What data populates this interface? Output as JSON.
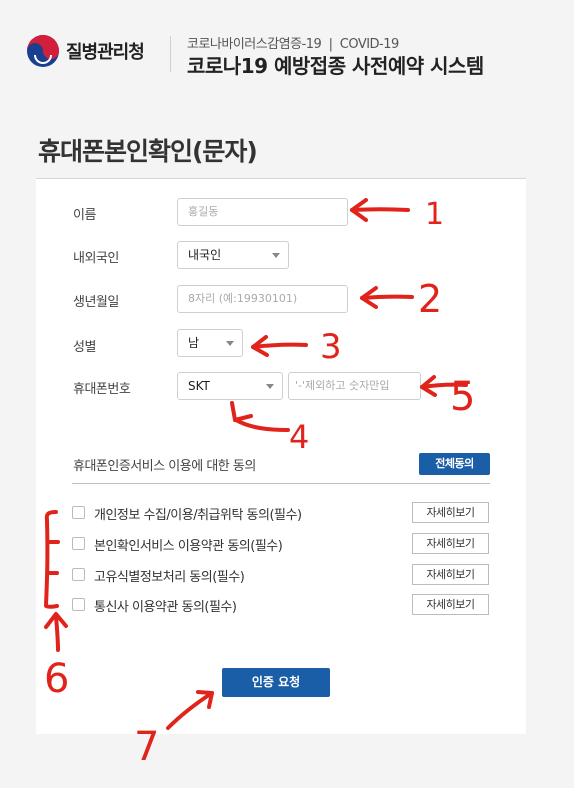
{
  "header": {
    "org_name": "질병관리청",
    "subtitle": "코로나바이러스감염증-19  |  COVID-19",
    "title": "코로나19 예방접종 사전예약 시스템"
  },
  "page_title": "휴대폰본인확인(문자)",
  "form": {
    "name_label": "이름",
    "name_placeholder": "홍길동",
    "nationality_label": "내외국인",
    "nationality_value": "내국인",
    "birth_label": "생년월일",
    "birth_placeholder": "8자리 (예:19930101)",
    "gender_label": "성별",
    "gender_value": "남",
    "phone_label": "휴대폰번호",
    "carrier_value": "SKT",
    "phone_placeholder": "'-'제외하고 숫자만입"
  },
  "consent": {
    "heading": "휴대폰인증서비스 이용에 대한 동의",
    "agree_all_label": "전체동의",
    "items": [
      {
        "label": "개인정보 수집/이용/취급위탁 동의(필수)",
        "detail": "자세히보기"
      },
      {
        "label": "본인확인서비스 이용약관 동의(필수)",
        "detail": "자세히보기"
      },
      {
        "label": "고유식별정보처리 동의(필수)",
        "detail": "자세히보기"
      },
      {
        "label": "통신사 이용약관 동의(필수)",
        "detail": "자세히보기"
      }
    ]
  },
  "submit_label": "인증 요청",
  "annotations": [
    "1",
    "2",
    "3",
    "4",
    "5",
    "6",
    "7"
  ],
  "colors": {
    "accent": "#1a5ea8",
    "annotation": "#e0241b"
  }
}
